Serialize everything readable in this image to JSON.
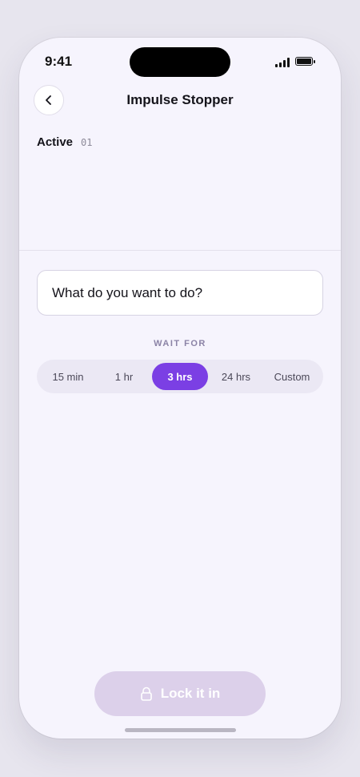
{
  "status_bar": {
    "time": "9:41"
  },
  "header": {
    "title": "Impulse Stopper"
  },
  "active": {
    "label": "Active",
    "count": "01"
  },
  "input": {
    "placeholder": "What do you want to do?"
  },
  "wait": {
    "label": "WAIT FOR",
    "options": [
      "15 min",
      "1 hr",
      "3 hrs",
      "24 hrs",
      "Custom"
    ],
    "selected": "3 hrs"
  },
  "action": {
    "label": "Lock it in"
  },
  "colors": {
    "accent": "#7b3fe4",
    "background": "#f6f4fd",
    "disabled_button": "#dcd0ea"
  },
  "icons": {
    "back": "chevron-left-icon",
    "lock": "lock-icon"
  }
}
